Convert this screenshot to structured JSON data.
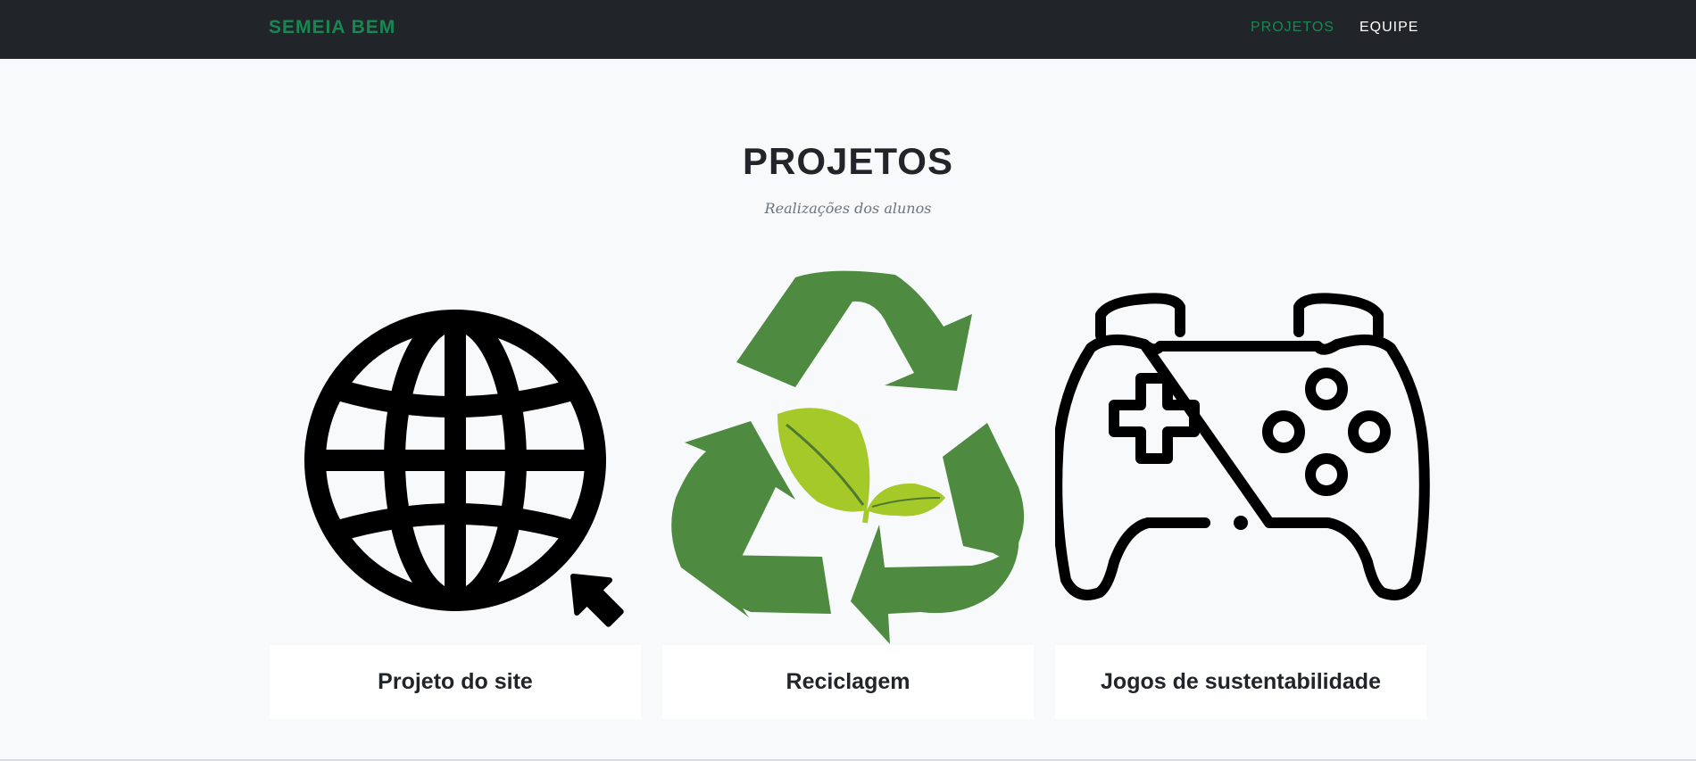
{
  "nav": {
    "brand": "SEMEIA BEM",
    "links": [
      {
        "label": "PROJETOS",
        "active": true
      },
      {
        "label": "EQUIPE",
        "active": false
      }
    ]
  },
  "section": {
    "title": "PROJETOS",
    "subtitle": "Realizações dos alunos"
  },
  "projects": [
    {
      "caption": "Projeto do site",
      "icon": "globe-cursor-icon"
    },
    {
      "caption": "Reciclagem",
      "icon": "recycle-leaves-icon"
    },
    {
      "caption": "Jogos de sustentabilidade",
      "icon": "gamepad-icon"
    }
  ],
  "colors": {
    "navbar_bg": "#212529",
    "accent": "#198754",
    "page_bg": "#f8f9fa",
    "recycle_green": "#4e8a40",
    "leaf_green": "#a6c92a"
  }
}
